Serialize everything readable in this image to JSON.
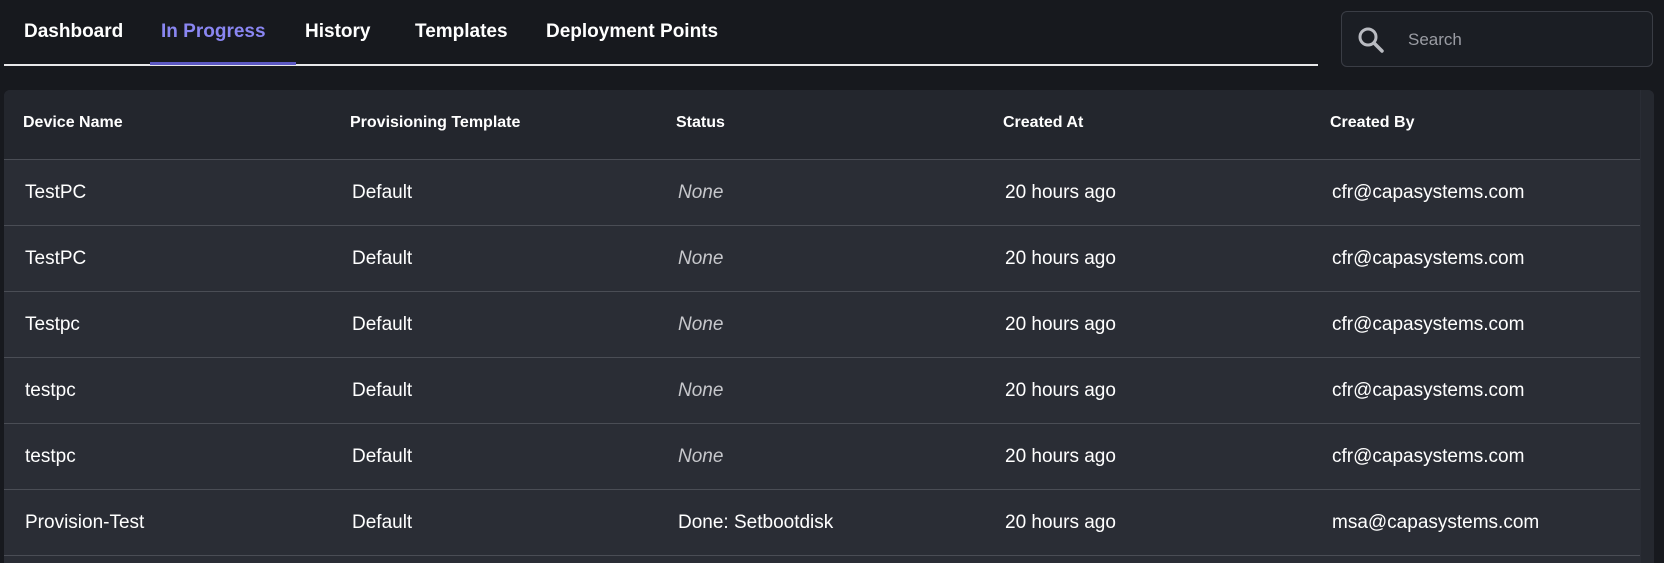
{
  "tabs": [
    {
      "label": "Dashboard",
      "active": false
    },
    {
      "label": "In Progress",
      "active": true
    },
    {
      "label": "History",
      "active": false
    },
    {
      "label": "Templates",
      "active": false
    },
    {
      "label": "Deployment Points",
      "active": false
    }
  ],
  "search": {
    "placeholder": "Search",
    "value": "",
    "icon": "search-icon"
  },
  "table": {
    "columns": [
      "Device Name",
      "Provisioning Template",
      "Status",
      "Created At",
      "Created By"
    ],
    "rows": [
      {
        "device": "TestPC",
        "template": "Default",
        "status": "None",
        "created_at": "20 hours ago",
        "created_by": "cfr@capasystems.com"
      },
      {
        "device": "TestPC",
        "template": "Default",
        "status": "None",
        "created_at": "20 hours ago",
        "created_by": "cfr@capasystems.com"
      },
      {
        "device": "Testpc",
        "template": "Default",
        "status": "None",
        "created_at": "20 hours ago",
        "created_by": "cfr@capasystems.com"
      },
      {
        "device": "testpc",
        "template": "Default",
        "status": "None",
        "created_at": "20 hours ago",
        "created_by": "cfr@capasystems.com"
      },
      {
        "device": "testpc",
        "template": "Default",
        "status": "None",
        "created_at": "20 hours ago",
        "created_by": "cfr@capasystems.com"
      },
      {
        "device": "Provision-Test",
        "template": "Default",
        "status": "Done: Setbootdisk",
        "created_at": "20 hours ago",
        "created_by": "msa@capasystems.com"
      }
    ]
  },
  "colors": {
    "background": "#17191e",
    "panel": "#2a2d35",
    "accent": "#8a86f2",
    "accent_underline": "#5d59c4"
  }
}
